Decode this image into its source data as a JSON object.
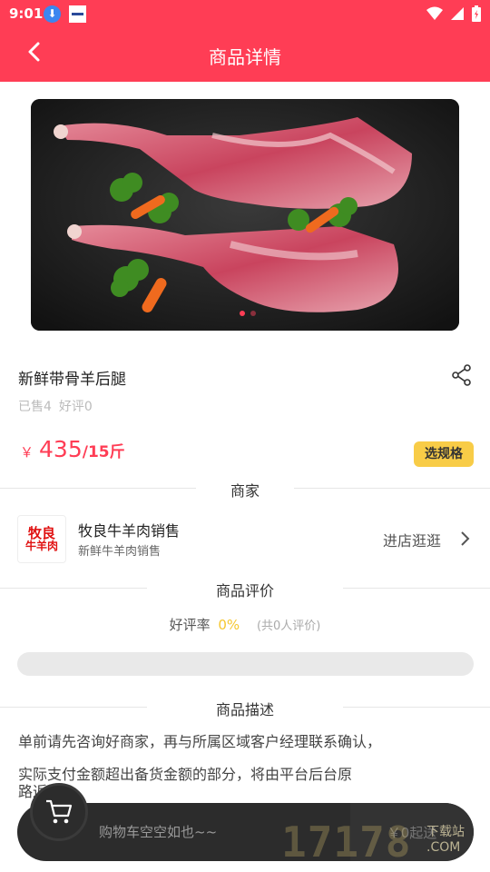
{
  "status_bar": {
    "time": "9:01"
  },
  "header": {
    "title": "商品详情"
  },
  "product": {
    "name": "新鲜带骨羊后腿",
    "sold": "已售4",
    "reviews": "好评0",
    "currency": "￥",
    "price": "435",
    "unit": "/15斤",
    "spec_button": "选规格",
    "image_alt": "two raw lamb legs with broccoli and carrots"
  },
  "merchant_section": {
    "heading": "商家",
    "logo_line1": "牧良",
    "logo_line2": "牛羊肉",
    "name": "牧良牛羊肉销售",
    "subtitle": "新鲜牛羊肉销售",
    "visit_label": "进店逛逛"
  },
  "review_section": {
    "heading": "商品评价",
    "rate_label": "好评率",
    "rate_value": "0%",
    "count_text": "(共0人评价)",
    "rate_fraction": 0
  },
  "description_section": {
    "heading": "商品描述",
    "line1": "单前请先咨询好商家，再与所属区域客户经理联系确认，",
    "line2": "实际支付金额超出备货金额的部分，将由平台后台原",
    "line3": "路返还"
  },
  "cart": {
    "empty_text": "购物车空空如也~~",
    "send_label": "￥0起送"
  },
  "watermark": {
    "digits": "17178",
    "tag": "下载站",
    "domain": ".COM"
  },
  "colors": {
    "accent": "#ff3d55",
    "spec": "#f8cc47",
    "rating": "#f5c730"
  },
  "icons": [
    "download-icon",
    "back-icon",
    "share-icon",
    "chevron-right-icon",
    "cart-icon",
    "wifi-icon",
    "signal-icon",
    "battery-icon"
  ]
}
